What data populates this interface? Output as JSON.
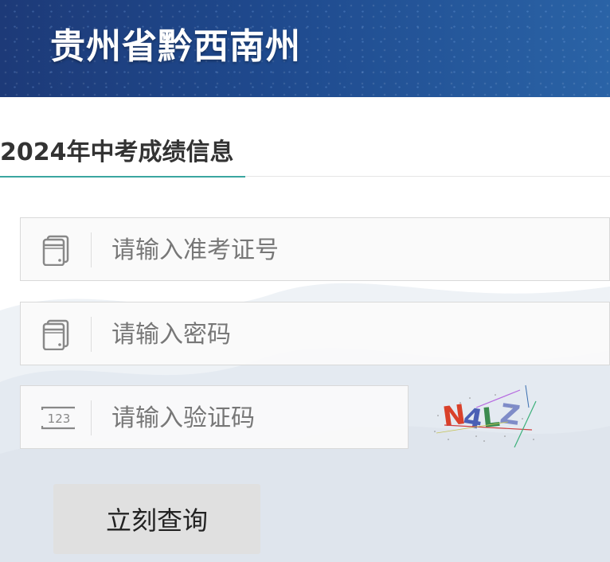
{
  "header": {
    "title": "贵州省黔西南州"
  },
  "section": {
    "title": "2024年中考成绩信息"
  },
  "form": {
    "exam_id": {
      "placeholder": "请输入准考证号",
      "value": ""
    },
    "password": {
      "placeholder": "请输入密码",
      "value": ""
    },
    "captcha": {
      "placeholder": "请输入验证码",
      "value": "",
      "image_text": "N4LZ"
    },
    "submit_label": "立刻查询"
  },
  "colors": {
    "header_bg": "#1f4a8e",
    "accent": "#3aa6a0",
    "button_bg": "#e0e0e0"
  }
}
